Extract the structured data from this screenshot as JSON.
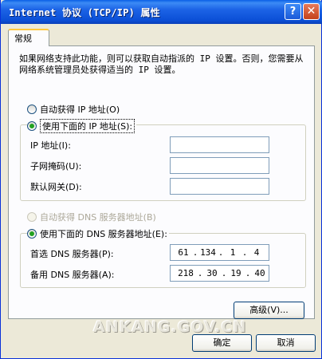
{
  "window": {
    "title": "Internet 协议 (TCP/IP) 属性",
    "help_label": "?",
    "close_label": "✕"
  },
  "tab": {
    "label": "常规"
  },
  "description": "如果网络支持此功能，则可以获取自动指派的 IP 设置。否则，您需要从网络系统管理员处获得适当的 IP 设置。",
  "ip": {
    "auto_label": "自动获得 IP 地址(O)",
    "manual_label": "使用下面的 IP 地址(S):",
    "selected": "manual",
    "address_label": "IP 地址(I):",
    "subnet_label": "子网掩码(U):",
    "gateway_label": "默认网关(D):",
    "address_value": "",
    "subnet_value": "",
    "gateway_value": ""
  },
  "dns": {
    "auto_label": "自动获得 DNS 服务器地址(B)",
    "manual_label": "使用下面的 DNS 服务器地址(E):",
    "selected": "manual",
    "preferred_label": "首选 DNS 服务器(P):",
    "alternate_label": "备用 DNS 服务器(A):",
    "preferred": [
      "61",
      "134",
      "1",
      "4"
    ],
    "alternate": [
      "218",
      "30",
      "19",
      "40"
    ]
  },
  "buttons": {
    "advanced": "高级(V)...",
    "ok": "确定",
    "cancel": "取消"
  },
  "watermark": "ANKANG.GOV.CN",
  "colors": {
    "titlebar": "#0b4fd6",
    "dialog_bg": "#ece9d8",
    "radio_dot": "#21a121",
    "tab_highlight": "#ffc73c"
  }
}
